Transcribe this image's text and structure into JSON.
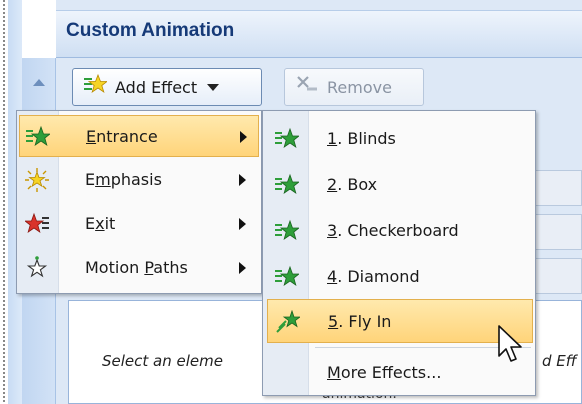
{
  "pane": {
    "title": "Custom Animation"
  },
  "toolbar": {
    "add_effect": {
      "label": "Add Effect",
      "icon": "add-effect-star-icon"
    },
    "remove": {
      "label": "Remove",
      "icon": "remove-icon",
      "enabled": false
    }
  },
  "menu": {
    "items": [
      {
        "key": "E",
        "rest": "ntrance",
        "icon": "entrance-star-icon",
        "color": "#2e9e3a",
        "highlighted": true,
        "has_submenu": true
      },
      {
        "pre": "E",
        "key": "m",
        "rest": "phasis",
        "icon": "emphasis-star-icon",
        "color": "#f2c318",
        "has_submenu": true
      },
      {
        "pre": "E",
        "key": "x",
        "rest": "it",
        "icon": "exit-star-icon",
        "color": "#d9332b",
        "has_submenu": true
      },
      {
        "pre": "Motion ",
        "key": "P",
        "rest": "aths",
        "icon": "motion-path-star-icon",
        "has_submenu": true
      }
    ]
  },
  "submenu": {
    "items": [
      {
        "key": "1",
        "rest": ". Blinds",
        "icon": "blinds-effect-icon"
      },
      {
        "key": "2",
        "rest": ". Box",
        "icon": "box-effect-icon"
      },
      {
        "key": "3",
        "rest": ". Checkerboard",
        "icon": "checkerboard-effect-icon"
      },
      {
        "key": "4",
        "rest": ". Diamond",
        "icon": "diamond-effect-icon"
      },
      {
        "key": "5",
        "rest": ". Fly In",
        "icon": "fly-in-effect-icon",
        "highlighted": true
      }
    ],
    "more": {
      "key": "M",
      "rest": "ore Effects..."
    }
  },
  "hint": {
    "left": "Select an eleme",
    "right": "d Eff",
    "sub": "animation."
  },
  "colors": {
    "accent": "#163a78",
    "highlight": "#ffd47a",
    "pane_bg": "#dde8f6"
  }
}
